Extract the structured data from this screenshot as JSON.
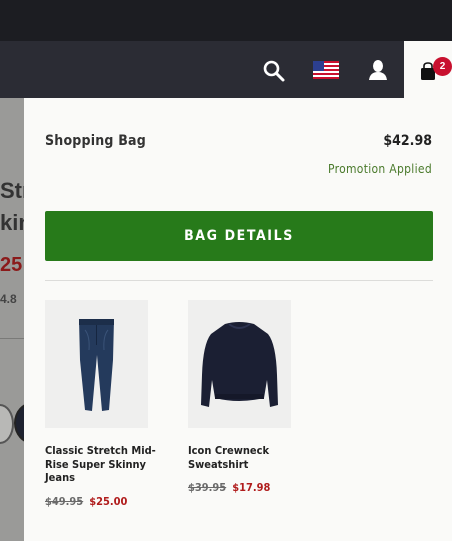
{
  "header": {
    "search_icon": "search-icon",
    "flag_icon": "us-flag-icon",
    "account_icon": "user-icon",
    "bag_icon": "shopping-bag-icon",
    "bag_count": "2"
  },
  "background_page": {
    "title_line1": "Str",
    "title_line2": "kin",
    "price": "25",
    "rating": "4.8"
  },
  "bag": {
    "title": "Shopping Bag",
    "total": "$42.98",
    "promo": "Promotion Applied",
    "button_label": "BAG DETAILS"
  },
  "items": [
    {
      "name": "Classic Stretch Mid-Rise Super Skinny Jeans",
      "original_price": "$49.95",
      "sale_price": "$25.00"
    },
    {
      "name": "Icon Crewneck Sweatshirt",
      "original_price": "$39.95",
      "sale_price": "$17.98"
    }
  ],
  "colors": {
    "header_bg": "#2b2c34",
    "button_green": "#277a1a",
    "promo_green": "#4a7a2c",
    "sale_red": "#b01c1c",
    "badge_red": "#c8102e"
  }
}
